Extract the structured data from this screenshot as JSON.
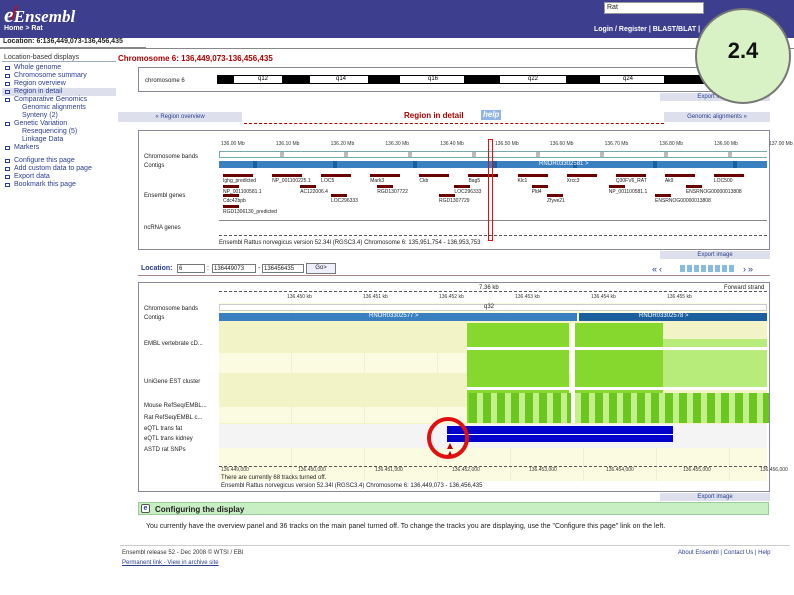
{
  "header": {
    "logo_e": "e",
    "logo_text": "Ensembl",
    "search_value": "Rat",
    "breadcrumb": "Home > Rat",
    "toplinks": "Login / Register | BLAST/BLAT | ...FAQs",
    "location_bar": "Location: 6:136,449,073-136,456,435"
  },
  "sidebar": {
    "heading": "Location-based displays",
    "items": [
      {
        "label": "Whole genome",
        "level": 0,
        "active": false
      },
      {
        "label": "Chromosome summary",
        "level": 0,
        "active": false
      },
      {
        "label": "Region overview",
        "level": 0,
        "active": false
      },
      {
        "label": "Region in detail",
        "level": 0,
        "active": true
      },
      {
        "label": "Comparative Genomics",
        "level": 0,
        "active": false
      },
      {
        "label": "Genomic alignments",
        "level": 1,
        "active": false
      },
      {
        "label": "Synteny (2)",
        "level": 1,
        "active": false
      },
      {
        "label": "Genetic Variation",
        "level": 0,
        "active": false
      },
      {
        "label": "Resequencing (5)",
        "level": 1,
        "active": false
      },
      {
        "label": "Linkage Data",
        "level": 1,
        "active": false
      },
      {
        "label": "Markers",
        "level": 0,
        "active": false
      }
    ],
    "actions": [
      {
        "label": "Configure this page"
      },
      {
        "label": "Add custom data to page"
      },
      {
        "label": "Export data"
      },
      {
        "label": "Bookmark this page"
      }
    ]
  },
  "page_title": "Chromosome 6: 136,449,073-136,456,435",
  "chromosome_panel": {
    "label": "chromosome 6",
    "bands": [
      "q12",
      "q14",
      "q16",
      "q22",
      "q24",
      "q32"
    ],
    "export": "Export image"
  },
  "region_nav": {
    "prev": "« Region overview",
    "title": "Region in detail",
    "help": "help",
    "next": "Genomic alignments »"
  },
  "overview_panel": {
    "ticks": [
      "136.00 Mb",
      "136.10 Mb",
      "136.20 Mb",
      "136.30 Mb",
      "136.40 Mb",
      "136.50 Mb",
      "136.60 Mb",
      "136.70 Mb",
      "136.80 Mb",
      "136.90 Mb",
      "137.00 Mb"
    ],
    "tracks": [
      {
        "label": "Chromosome bands"
      },
      {
        "label": "Contigs"
      },
      {
        "label": "Ensembl genes"
      },
      {
        "label": "ncRNA genes"
      }
    ],
    "contig_text": "RNOR03302581 >",
    "genes_row1": [
      "Ighg_predicted",
      "NP_001100225.1",
      "LOC5",
      "Mark3",
      "Ckb",
      "Bag5",
      "Klc1",
      "Xrcc3",
      "Q30FV6_RAT",
      "Ak9",
      "LOC500"
    ],
    "genes_row2": [
      "NP_001100581.1",
      "AC122006.4",
      "RGD1307722",
      "LOC296333",
      "Pld4",
      "NP_001100581.1",
      "ENSRNOG00000013808"
    ],
    "genes_row3": [
      "Cdc42bpb",
      "LOC296333",
      "RGD1307729",
      "Zfyve21",
      "ENSRNOG00000013808"
    ],
    "genes_row4": [
      "RGD1306130_predicted"
    ],
    "footer": "Ensembl Rattus norvegicus version 52.34l (RGSC3.4) Chromosome 6: 135,951,754 - 136,953,753",
    "export": "Export image"
  },
  "location_form": {
    "label": "Location:",
    "chr": "6",
    "start": "136449073",
    "end": "136456435",
    "go": "Go>"
  },
  "detail_panel": {
    "scale": "7.36 kb",
    "forward": "Forward strand",
    "ticks": [
      "136.450 kb",
      "136.451 kb",
      "136.452 kb",
      "136.453 kb",
      "136.454 kb",
      "136.455 kb"
    ],
    "bottom_ticks": [
      "136.449,000",
      "136.450,000",
      "136.451,000",
      "136.452,000",
      "136.453,000",
      "136.454,000",
      "136.455,000",
      "136.456,000"
    ],
    "contig_name": "q32",
    "contigs": [
      "RNOR03302577 >",
      "RNOR03302578 >"
    ],
    "tracks": [
      {
        "label": "Chromosome bands"
      },
      {
        "label": "Contigs"
      },
      {
        "label": "EMBL vertebrate cD..."
      },
      {
        "label": "UniGene EST cluster"
      },
      {
        "label": "Mouse RefSeq/EMBL..."
      },
      {
        "label": "Rat RefSeq/EMBL c..."
      },
      {
        "label": "eQTL trans fat"
      },
      {
        "label": "eQTL trans kidney"
      },
      {
        "label": "ASTD rat SNPs"
      }
    ],
    "info": "There are currently 68 tracks turned off.",
    "footer": "Ensembl Rattus norvegicus version 52.34l (RGSC3.4) Chromosome 6: 136,449,073 - 136,456,435",
    "export": "Export image"
  },
  "configure": {
    "title": "Configuring the display",
    "body": "You currently have the overview panel and 36 tracks on the main panel turned off. To change the tracks you are displaying, use the \"Configure this page\" link on the left."
  },
  "footer": {
    "left1": "Ensembl release 52 - Dec 2008 © WTSI / EBI",
    "left2": "Permanent link - View in archive site",
    "right": "About Ensembl | Contact Us | Help"
  },
  "annotation": {
    "badge": "2.4"
  },
  "colors": {
    "header": "#3e3e8e",
    "link": "#2a3d8f",
    "green": "#7cd62c",
    "blue": "#0000cc",
    "gene": "#6c0000",
    "highlight": "#e01010"
  }
}
